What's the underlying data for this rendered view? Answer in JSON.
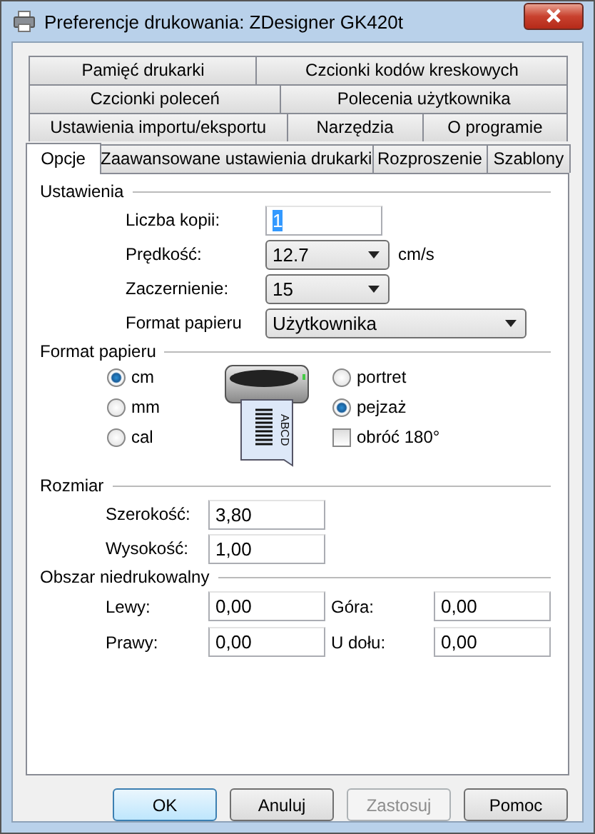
{
  "window": {
    "title": "Preferencje drukowania: ZDesigner GK420t"
  },
  "tab_rows": [
    [
      {
        "label": "Pamięć drukarki",
        "selected": false
      },
      {
        "label": "Czcionki kodów kreskowych",
        "selected": false
      }
    ],
    [
      {
        "label": "Czcionki poleceń",
        "selected": false
      },
      {
        "label": "Polecenia użytkownika",
        "selected": false
      }
    ],
    [
      {
        "label": "Ustawienia importu/eksportu",
        "selected": false
      },
      {
        "label": "Narzędzia",
        "selected": false
      },
      {
        "label": "O programie",
        "selected": false
      }
    ],
    [
      {
        "label": "Opcje",
        "selected": true
      },
      {
        "label": "Zaawansowane ustawienia drukarki",
        "selected": false
      },
      {
        "label": "Rozproszenie",
        "selected": false
      },
      {
        "label": "Szablony",
        "selected": false
      }
    ]
  ],
  "settings": {
    "title": "Ustawienia",
    "fields": [
      {
        "kind": "input",
        "label": "Liczba kopii:",
        "value": "1",
        "value_selected": true
      },
      {
        "kind": "select",
        "label": "Prędkość:",
        "value": "12.7",
        "unit": "cm/s"
      },
      {
        "kind": "select",
        "label": "Zaczernienie:",
        "value": "15"
      },
      {
        "kind": "wide-select",
        "label": "Format papieru",
        "value": "Użytkownika"
      }
    ]
  },
  "paper_format": {
    "title": "Format papieru",
    "units": [
      {
        "label": "cm",
        "selected": true
      },
      {
        "label": "mm",
        "selected": false
      },
      {
        "label": "cal",
        "selected": false
      }
    ],
    "orientations": [
      {
        "label": "portret",
        "selected": false
      },
      {
        "label": "pejzaż",
        "selected": true
      }
    ],
    "rotate": {
      "label": "obróć 180°",
      "checked": false
    },
    "preview": {
      "label_text": "ABCD"
    }
  },
  "size": {
    "title": "Rozmiar",
    "fields": [
      {
        "label": "Szerokość:",
        "value": "3,80"
      },
      {
        "label": "Wysokość:",
        "value": "1,00"
      }
    ]
  },
  "margins": {
    "title": "Obszar niedrukowalny",
    "fields": [
      {
        "label": "Lewy:",
        "value": "0,00"
      },
      {
        "label": "Góra:",
        "value": "0,00"
      },
      {
        "label": "Prawy:",
        "value": "0,00"
      },
      {
        "label": "U dołu:",
        "value": "0,00"
      }
    ]
  },
  "buttons": [
    {
      "label": "OK",
      "default": true,
      "disabled": false
    },
    {
      "label": "Anuluj",
      "default": false,
      "disabled": false
    },
    {
      "label": "Zastosuj",
      "default": false,
      "disabled": true
    },
    {
      "label": "Pomoc",
      "default": false,
      "disabled": false
    }
  ]
}
